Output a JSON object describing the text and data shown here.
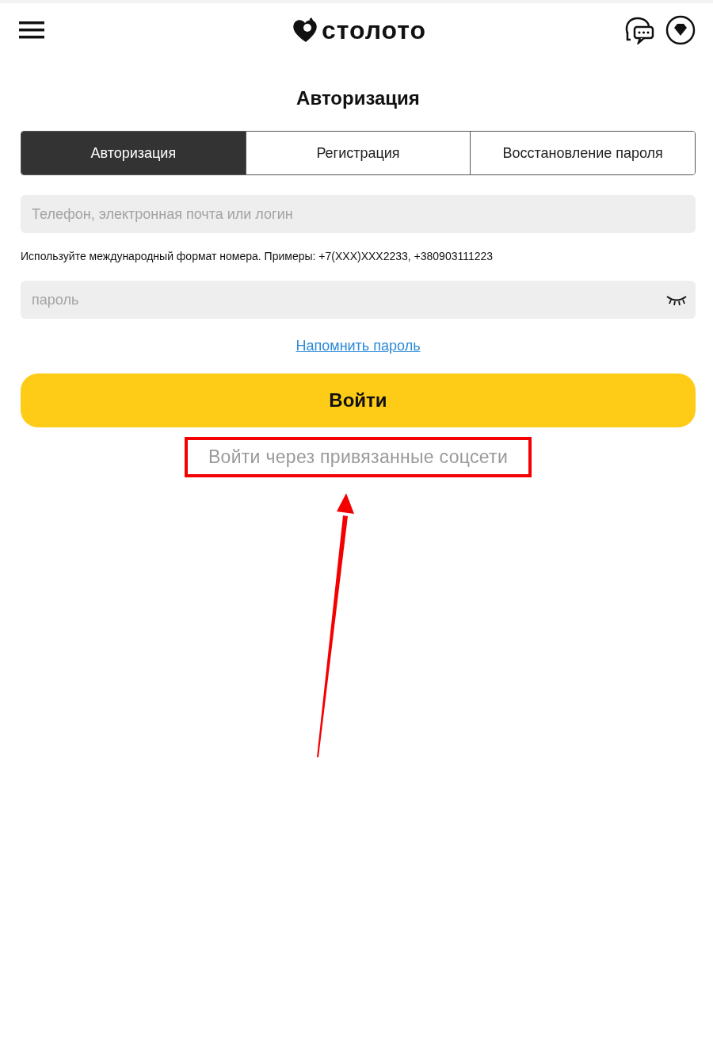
{
  "header": {
    "logo_text": "столото"
  },
  "title": "Авторизация",
  "tabs": [
    {
      "label": "Авторизация",
      "selected": true
    },
    {
      "label": "Регистрация",
      "selected": false
    },
    {
      "label": "Восстановление пароля",
      "selected": false
    }
  ],
  "login_field": {
    "placeholder": "Телефон, электронная почта или логин"
  },
  "hint": "Используйте международный формат номера. Примеры: +7(XXX)XXX2233, +380903111223",
  "password_field": {
    "placeholder": "пароль"
  },
  "remind_link": "Напомнить пароль",
  "submit_button": "Войти",
  "social_login": {
    "label": "Войти через привязанные соцсети",
    "highlighted": true,
    "arrow": true
  }
}
